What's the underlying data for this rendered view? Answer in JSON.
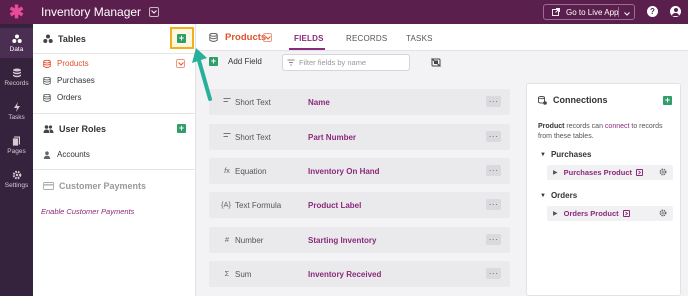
{
  "app": {
    "title": "Inventory Manager",
    "live_app_label": "Go to Live App",
    "colors": {
      "brand": "#5b1f4e",
      "accent": "#8b2a7a",
      "active": "#e0522a",
      "add": "#2f9e6a",
      "highlight": "#f2b01e",
      "arrow": "#27b09a"
    }
  },
  "rail": {
    "items": [
      {
        "label": "Data",
        "icon": "data-icon"
      },
      {
        "label": "Records",
        "icon": "records-icon"
      },
      {
        "label": "Tasks",
        "icon": "tasks-icon"
      },
      {
        "label": "Pages",
        "icon": "pages-icon"
      },
      {
        "label": "Settings",
        "icon": "settings-icon"
      }
    ]
  },
  "tables_panel": {
    "heading": "Tables",
    "tables": [
      {
        "label": "Products"
      },
      {
        "label": "Purchases"
      },
      {
        "label": "Orders"
      }
    ],
    "user_roles_heading": "User Roles",
    "user_roles": [
      {
        "label": "Accounts"
      }
    ],
    "customer_payments_heading": "Customer Payments",
    "enable_payments_link": "Enable Customer Payments"
  },
  "main": {
    "table_title": "Products",
    "tabs": [
      {
        "label": "FIELDS"
      },
      {
        "label": "RECORDS"
      },
      {
        "label": "TASKS"
      }
    ],
    "add_field_label": "Add Field",
    "filter_placeholder": "Filter fields by name",
    "fields": [
      {
        "type": "Short Text",
        "name": "Name",
        "icon": "short-text-icon"
      },
      {
        "type": "Short Text",
        "name": "Part Number",
        "icon": "short-text-icon"
      },
      {
        "type": "Equation",
        "name": "Inventory On Hand",
        "icon": "equation-icon"
      },
      {
        "type": "Text Formula",
        "name": "Product Label",
        "icon": "text-formula-icon"
      },
      {
        "type": "Number",
        "name": "Starting Inventory",
        "icon": "number-icon"
      },
      {
        "type": "Sum",
        "name": "Inventory Received",
        "icon": "sum-icon"
      }
    ]
  },
  "connections": {
    "title": "Connections",
    "desc_table": "Product",
    "desc_mid1": " records can ",
    "desc_link": "connect",
    "desc_mid2": " to records from these tables.",
    "groups": [
      {
        "label": "Purchases",
        "item": "Purchases Product"
      },
      {
        "label": "Orders",
        "item": "Orders Product"
      }
    ]
  }
}
